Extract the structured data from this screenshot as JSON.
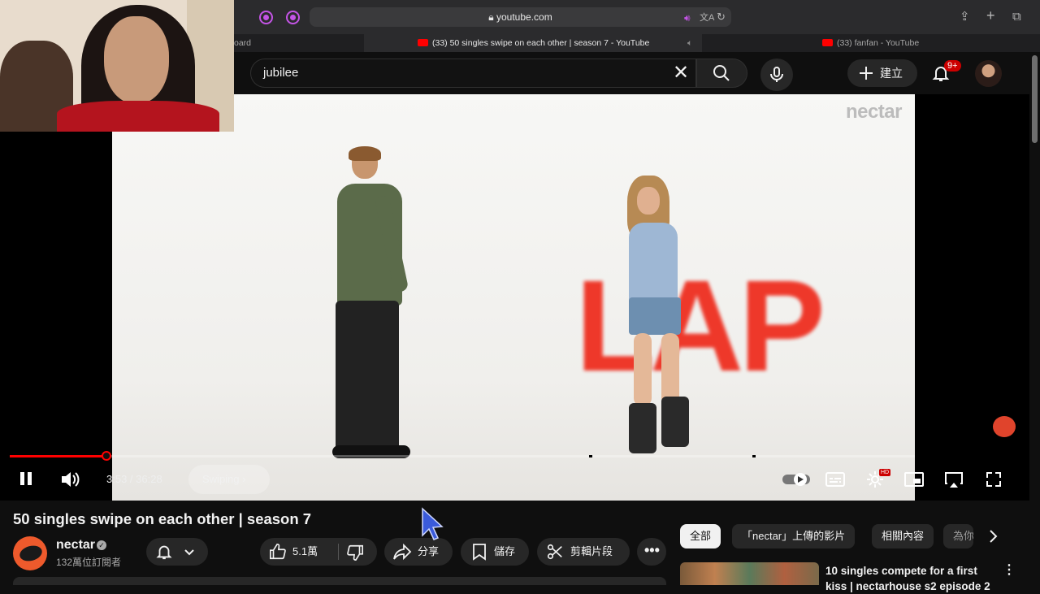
{
  "browser": {
    "url": "youtube.com",
    "tabs": [
      {
        "label": "oard",
        "active": false
      },
      {
        "label": "(33) 50 singles swipe on each other | season 7 - YouTube",
        "active": true
      },
      {
        "label": "(33) fanfan - YouTube",
        "active": false
      }
    ]
  },
  "header": {
    "search_value": "jubilee",
    "create_label": "建立",
    "notifications_badge": "9+"
  },
  "video": {
    "watermark": "nectar",
    "overlay_text": "LAP",
    "current_time": "3:53",
    "duration": "36:28",
    "time_display": "3:53 / 36:28",
    "chapter_label": "Swiping",
    "hd_badge": "HD",
    "progress_fraction": 0.107
  },
  "meta": {
    "title": "50 singles swipe on each other | season 7",
    "channel_name": "nectar",
    "subscribers": "132萬位訂閱者",
    "like_count": "5.1萬",
    "share_label": "分享",
    "save_label": "儲存",
    "clip_label": "剪輯片段"
  },
  "sidebar": {
    "chips": [
      "全部",
      "「nectar」上傳的影片",
      "相關內容",
      "為你"
    ],
    "related_title": "10 singles compete for a first kiss | nectarhouse s2 episode 2"
  },
  "colors": {
    "accent_red": "#ff0000",
    "overlay_red": "#ee2b1c",
    "background": "#0f0f0f"
  }
}
